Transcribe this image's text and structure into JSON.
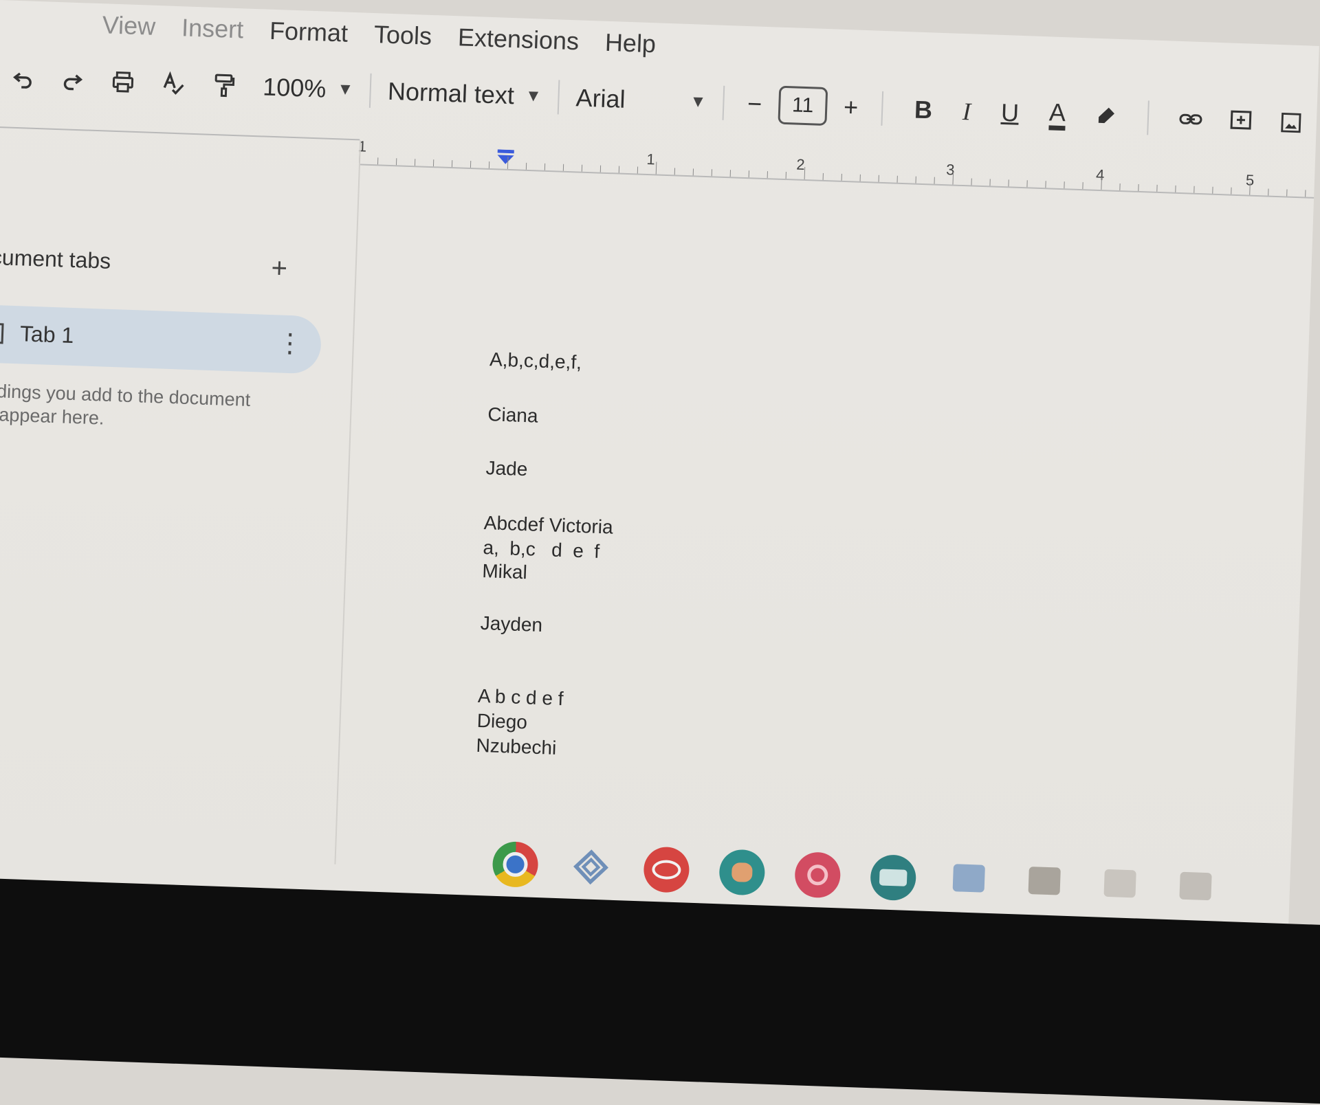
{
  "menu": {
    "items": [
      "View",
      "Insert",
      "Format",
      "Tools",
      "Extensions",
      "Help"
    ]
  },
  "toolbar": {
    "zoom": "100%",
    "style": "Normal text",
    "font": "Arial",
    "font_size": "11",
    "bold": "B",
    "italic": "I",
    "underline": "U",
    "text_color": "A",
    "minus": "−",
    "plus": "+"
  },
  "ruler": {
    "left_margin_number": "1",
    "numbers": [
      "1",
      "2",
      "3",
      "4",
      "5"
    ]
  },
  "sidebar": {
    "title": "cument tabs",
    "add_symbol": "+",
    "tab_label": "Tab 1",
    "tab_menu_symbol": "⋮",
    "hint_line1": "adings you add to the document",
    "hint_line2": "ll appear here."
  },
  "document": {
    "lines": [
      "A,b,c,d,e,f,",
      "Ciana",
      "Jade",
      "Abcdef Victoria",
      "a,  b,c   d  e  f",
      "Mikal",
      "Jayden",
      "A b c d e f",
      "Diego",
      "Nzubechi"
    ]
  },
  "icons": {
    "undo": "undo-icon",
    "redo": "redo-icon",
    "print": "print-icon",
    "spellcheck": "spellcheck-icon",
    "paint_format": "paint-format-icon",
    "highlight": "highlighter-icon",
    "link": "link-icon",
    "comment": "add-comment-icon",
    "image": "insert-image-icon"
  },
  "colors": {
    "tab_active": "#cfd9e3",
    "indent_marker": "#3b5bdb",
    "chrome_red": "#d64541",
    "teal": "#2f8f8c",
    "pink": "#d24c62"
  }
}
